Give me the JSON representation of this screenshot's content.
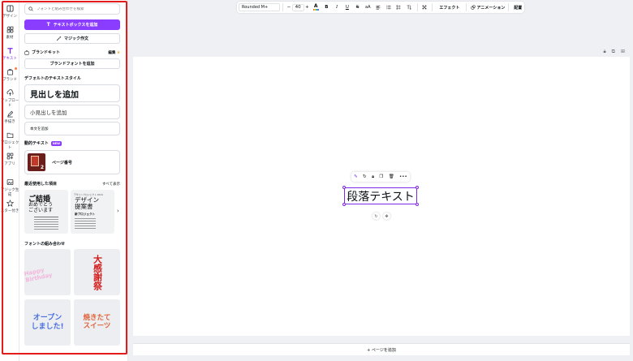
{
  "rail": {
    "items": [
      {
        "label": "デザイン",
        "icon": "design-icon"
      },
      {
        "label": "素材",
        "icon": "elements-icon"
      },
      {
        "label": "テキスト",
        "icon": "text-icon"
      },
      {
        "label": "ブランド",
        "icon": "brand-icon"
      },
      {
        "label": "アップロード",
        "icon": "upload-icon"
      },
      {
        "label": "手描き",
        "icon": "draw-icon"
      },
      {
        "label": "プロジェクト",
        "icon": "project-icon"
      },
      {
        "label": "アプリ",
        "icon": "apps-icon"
      },
      {
        "label": "マジック生成",
        "icon": "magic-media-icon"
      },
      {
        "label": "スター付き",
        "icon": "star-icon"
      }
    ]
  },
  "panel": {
    "search_placeholder": "フォントと組み合わせを検索",
    "add_textbox": "テキストボックスを追加",
    "magic_write": "マジック作文",
    "brand_kit": "ブランドキット",
    "brand_edit": "編集",
    "add_brand_font": "ブランドフォントを追加",
    "default_styles_heading": "デフォルトのテキストスタイル",
    "heading": "見出しを追加",
    "subheading": "小見出しを追加",
    "body": "本文を追加",
    "dynamic_text": "動的テキスト",
    "new_badge": "NEW",
    "page_number": "ページ番号",
    "page_number_thumb": "2",
    "recently_used": "最近使用した項目",
    "see_all": "すべて表示",
    "recent1_title": "ご結婚",
    "recent1_sub": "おめでとう\nございます",
    "recent2_title": "デザイン\n提案書",
    "recent2_sub": "新プロジェクト",
    "recent2_top": "デザインプロジェクト 2024",
    "font_combos": "フォントの組み合わせ",
    "combo1": "Happy Birthday",
    "combo2": "大感謝祭",
    "combo3": "オープン\nしました!",
    "combo4": "焼きたて\nスイーツ"
  },
  "toolbar": {
    "font_name": "Rounded M+",
    "font_size": "40",
    "effects": "エフェクト",
    "animate": "アニメーション",
    "position": "配置"
  },
  "canvas": {
    "text": "段落テキスト",
    "add_page": "+ ページを追加"
  },
  "colors": {
    "accent": "#8b3dff",
    "highlight_outline": "#e21b1b"
  }
}
